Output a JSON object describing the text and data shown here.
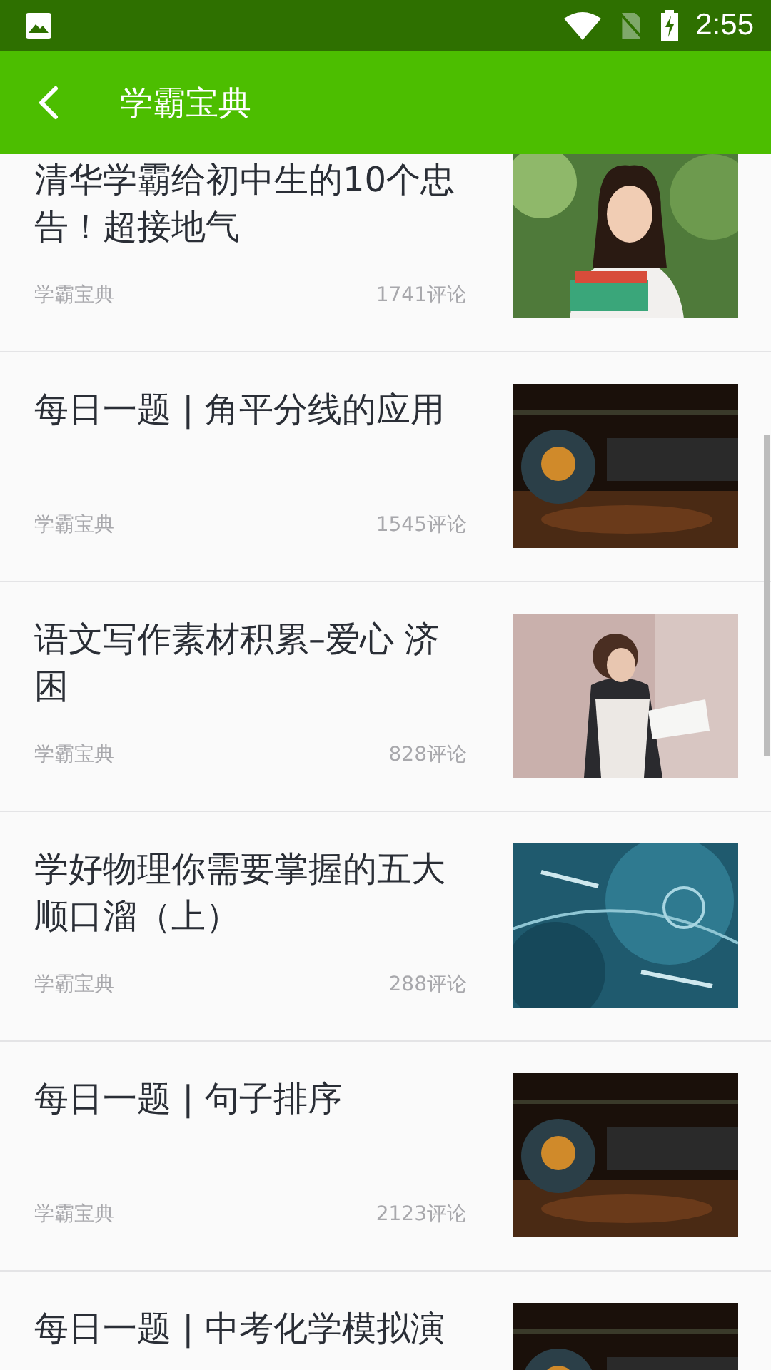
{
  "status_bar": {
    "time": "2:55"
  },
  "app_bar": {
    "title": "学霸宝典"
  },
  "articles": [
    {
      "title": "清华学霸给初中生的10个忠告！超接地气",
      "source": "学霸宝典",
      "comments": "1741评论"
    },
    {
      "title": "每日一题 | 角平分线的应用",
      "source": "学霸宝典",
      "comments": "1545评论"
    },
    {
      "title": "语文写作素材积累–爱心 济困",
      "source": "学霸宝典",
      "comments": "828评论"
    },
    {
      "title": "学好物理你需要掌握的五大顺口溜（上）",
      "source": "学霸宝典",
      "comments": "288评论"
    },
    {
      "title": "每日一题 | 句子排序",
      "source": "学霸宝典",
      "comments": "2123评论"
    },
    {
      "title": "每日一题 | 中考化学模拟演"
    }
  ]
}
